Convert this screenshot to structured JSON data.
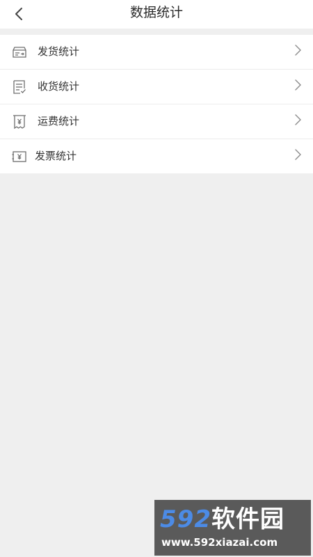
{
  "header": {
    "title": "数据统计",
    "back_icon": "chevron-left-icon"
  },
  "menu": {
    "items": [
      {
        "label": "发货统计",
        "icon": "truck-box-icon"
      },
      {
        "label": "收货统计",
        "icon": "document-check-icon"
      },
      {
        "label": "运费统计",
        "icon": "receipt-yen-icon"
      },
      {
        "label": "发票统计",
        "icon": "invoice-yen-icon"
      }
    ],
    "chevron_icon": "chevron-right-icon"
  },
  "watermark": {
    "brand_number": "592",
    "brand_name": "软件园",
    "url": "www.592xiazai.com"
  },
  "colors": {
    "background": "#efefef",
    "surface": "#ffffff",
    "text": "#333333",
    "icon": "#6d6d6d",
    "watermark_accent": "#4c8be6"
  }
}
